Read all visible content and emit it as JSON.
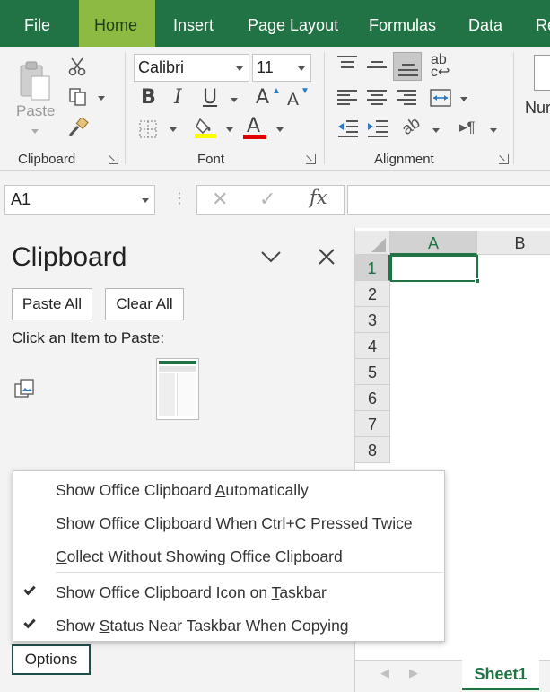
{
  "tabs": [
    "File",
    "Home",
    "Insert",
    "Page Layout",
    "Formulas",
    "Data",
    "Re"
  ],
  "active_tab": "Home",
  "ribbon": {
    "clipboard": {
      "label": "Clipboard",
      "paste_label": "Paste"
    },
    "font": {
      "label": "Font",
      "font_name": "Calibri",
      "font_size": "11",
      "bold": "B",
      "italic": "I",
      "underline": "U",
      "grow": "A",
      "shrink": "A",
      "font_color_letter": "A",
      "highlight_color": "#ffff00",
      "font_color": "#e00000"
    },
    "alignment": {
      "label": "Alignment"
    },
    "number": {
      "partial_label": "Nur"
    }
  },
  "formula_bar": {
    "name_box": "A1",
    "fx": "fx",
    "formula": ""
  },
  "clipboard_pane": {
    "title": "Clipboard",
    "paste_all": "Paste All",
    "clear_all": "Clear All",
    "hint": "Click an Item to Paste:",
    "options_label": "Options"
  },
  "options_menu": {
    "items": [
      {
        "pre": "Show Office Clipboard ",
        "key": "A",
        "post": "utomatically",
        "checked": false
      },
      {
        "pre": "Show Office Clipboard When Ctrl+C ",
        "key": "P",
        "post": "ressed Twice",
        "checked": false
      },
      {
        "pre": "",
        "key": "C",
        "post": "ollect Without Showing Office Clipboard",
        "checked": false
      },
      {
        "pre": "Show Office Clipboard Icon on ",
        "key": "T",
        "post": "askbar",
        "checked": true
      },
      {
        "pre": "Show ",
        "key": "S",
        "post": "tatus Near Taskbar When Copying",
        "checked": true
      }
    ]
  },
  "sheet": {
    "columns": [
      "A",
      "B"
    ],
    "rows": [
      "1",
      "2",
      "3",
      "4",
      "5",
      "6",
      "7",
      "8"
    ],
    "active_cell": "A1",
    "sheet_tab": "Sheet1",
    "accent": "#217346"
  }
}
